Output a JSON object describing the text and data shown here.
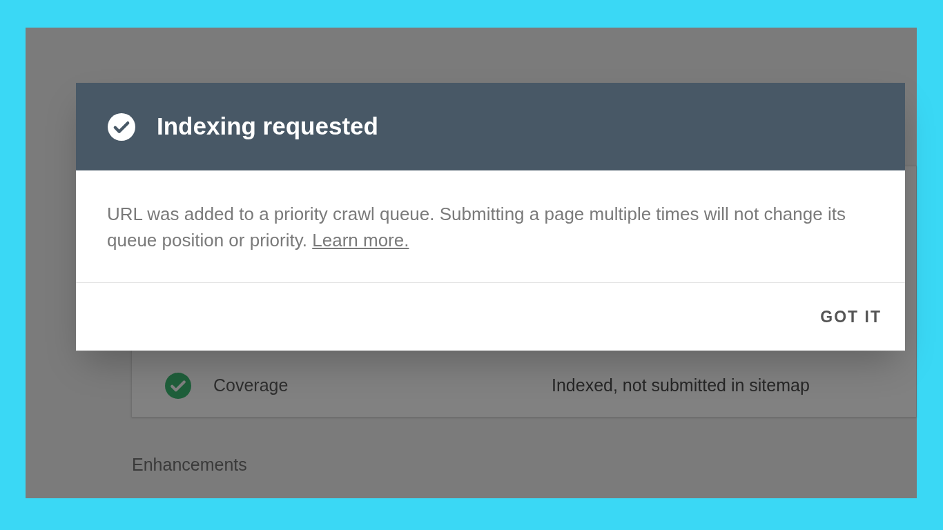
{
  "background": {
    "rows": [
      {
        "label": "Coverage",
        "value": "Indexed, not submitted in sitemap",
        "valid": true
      }
    ],
    "section_heading": "Enhancements"
  },
  "dialog": {
    "title": "Indexing requested",
    "message": "URL was added to a priority crawl queue. Submitting a page multiple times will not change its queue position or priority.",
    "link": "Learn more.",
    "button": "GOT IT"
  }
}
